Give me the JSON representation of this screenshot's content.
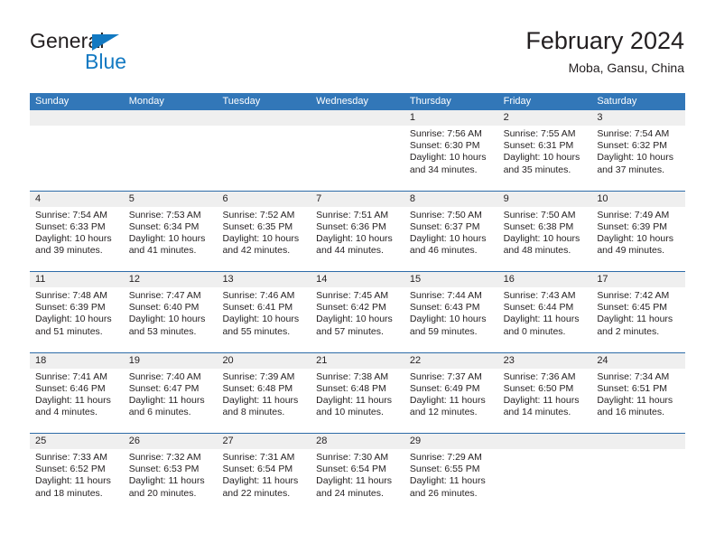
{
  "brand": {
    "name_part1": "General",
    "name_part2": "Blue",
    "triangle_icon": "blue-triangle-logo-mark",
    "accent_color": "#1279c2"
  },
  "header": {
    "title": "February 2024",
    "subtitle": "Moba, Gansu, China"
  },
  "theme": {
    "header_blue": "#3277b8",
    "row_divider_blue": "#2e6ca8",
    "daynum_band_gray": "#efefef",
    "text_color": "#231f20"
  },
  "calendar": {
    "weekday_headers": [
      "Sunday",
      "Monday",
      "Tuesday",
      "Wednesday",
      "Thursday",
      "Friday",
      "Saturday"
    ],
    "weeks": [
      [
        {
          "day": "",
          "lines": []
        },
        {
          "day": "",
          "lines": []
        },
        {
          "day": "",
          "lines": []
        },
        {
          "day": "",
          "lines": []
        },
        {
          "day": "1",
          "lines": [
            "Sunrise: 7:56 AM",
            "Sunset: 6:30 PM",
            "Daylight: 10 hours",
            "and 34 minutes."
          ]
        },
        {
          "day": "2",
          "lines": [
            "Sunrise: 7:55 AM",
            "Sunset: 6:31 PM",
            "Daylight: 10 hours",
            "and 35 minutes."
          ]
        },
        {
          "day": "3",
          "lines": [
            "Sunrise: 7:54 AM",
            "Sunset: 6:32 PM",
            "Daylight: 10 hours",
            "and 37 minutes."
          ]
        }
      ],
      [
        {
          "day": "4",
          "lines": [
            "Sunrise: 7:54 AM",
            "Sunset: 6:33 PM",
            "Daylight: 10 hours",
            "and 39 minutes."
          ]
        },
        {
          "day": "5",
          "lines": [
            "Sunrise: 7:53 AM",
            "Sunset: 6:34 PM",
            "Daylight: 10 hours",
            "and 41 minutes."
          ]
        },
        {
          "day": "6",
          "lines": [
            "Sunrise: 7:52 AM",
            "Sunset: 6:35 PM",
            "Daylight: 10 hours",
            "and 42 minutes."
          ]
        },
        {
          "day": "7",
          "lines": [
            "Sunrise: 7:51 AM",
            "Sunset: 6:36 PM",
            "Daylight: 10 hours",
            "and 44 minutes."
          ]
        },
        {
          "day": "8",
          "lines": [
            "Sunrise: 7:50 AM",
            "Sunset: 6:37 PM",
            "Daylight: 10 hours",
            "and 46 minutes."
          ]
        },
        {
          "day": "9",
          "lines": [
            "Sunrise: 7:50 AM",
            "Sunset: 6:38 PM",
            "Daylight: 10 hours",
            "and 48 minutes."
          ]
        },
        {
          "day": "10",
          "lines": [
            "Sunrise: 7:49 AM",
            "Sunset: 6:39 PM",
            "Daylight: 10 hours",
            "and 49 minutes."
          ]
        }
      ],
      [
        {
          "day": "11",
          "lines": [
            "Sunrise: 7:48 AM",
            "Sunset: 6:39 PM",
            "Daylight: 10 hours",
            "and 51 minutes."
          ]
        },
        {
          "day": "12",
          "lines": [
            "Sunrise: 7:47 AM",
            "Sunset: 6:40 PM",
            "Daylight: 10 hours",
            "and 53 minutes."
          ]
        },
        {
          "day": "13",
          "lines": [
            "Sunrise: 7:46 AM",
            "Sunset: 6:41 PM",
            "Daylight: 10 hours",
            "and 55 minutes."
          ]
        },
        {
          "day": "14",
          "lines": [
            "Sunrise: 7:45 AM",
            "Sunset: 6:42 PM",
            "Daylight: 10 hours",
            "and 57 minutes."
          ]
        },
        {
          "day": "15",
          "lines": [
            "Sunrise: 7:44 AM",
            "Sunset: 6:43 PM",
            "Daylight: 10 hours",
            "and 59 minutes."
          ]
        },
        {
          "day": "16",
          "lines": [
            "Sunrise: 7:43 AM",
            "Sunset: 6:44 PM",
            "Daylight: 11 hours",
            "and 0 minutes."
          ]
        },
        {
          "day": "17",
          "lines": [
            "Sunrise: 7:42 AM",
            "Sunset: 6:45 PM",
            "Daylight: 11 hours",
            "and 2 minutes."
          ]
        }
      ],
      [
        {
          "day": "18",
          "lines": [
            "Sunrise: 7:41 AM",
            "Sunset: 6:46 PM",
            "Daylight: 11 hours",
            "and 4 minutes."
          ]
        },
        {
          "day": "19",
          "lines": [
            "Sunrise: 7:40 AM",
            "Sunset: 6:47 PM",
            "Daylight: 11 hours",
            "and 6 minutes."
          ]
        },
        {
          "day": "20",
          "lines": [
            "Sunrise: 7:39 AM",
            "Sunset: 6:48 PM",
            "Daylight: 11 hours",
            "and 8 minutes."
          ]
        },
        {
          "day": "21",
          "lines": [
            "Sunrise: 7:38 AM",
            "Sunset: 6:48 PM",
            "Daylight: 11 hours",
            "and 10 minutes."
          ]
        },
        {
          "day": "22",
          "lines": [
            "Sunrise: 7:37 AM",
            "Sunset: 6:49 PM",
            "Daylight: 11 hours",
            "and 12 minutes."
          ]
        },
        {
          "day": "23",
          "lines": [
            "Sunrise: 7:36 AM",
            "Sunset: 6:50 PM",
            "Daylight: 11 hours",
            "and 14 minutes."
          ]
        },
        {
          "day": "24",
          "lines": [
            "Sunrise: 7:34 AM",
            "Sunset: 6:51 PM",
            "Daylight: 11 hours",
            "and 16 minutes."
          ]
        }
      ],
      [
        {
          "day": "25",
          "lines": [
            "Sunrise: 7:33 AM",
            "Sunset: 6:52 PM",
            "Daylight: 11 hours",
            "and 18 minutes."
          ]
        },
        {
          "day": "26",
          "lines": [
            "Sunrise: 7:32 AM",
            "Sunset: 6:53 PM",
            "Daylight: 11 hours",
            "and 20 minutes."
          ]
        },
        {
          "day": "27",
          "lines": [
            "Sunrise: 7:31 AM",
            "Sunset: 6:54 PM",
            "Daylight: 11 hours",
            "and 22 minutes."
          ]
        },
        {
          "day": "28",
          "lines": [
            "Sunrise: 7:30 AM",
            "Sunset: 6:54 PM",
            "Daylight: 11 hours",
            "and 24 minutes."
          ]
        },
        {
          "day": "29",
          "lines": [
            "Sunrise: 7:29 AM",
            "Sunset: 6:55 PM",
            "Daylight: 11 hours",
            "and 26 minutes."
          ]
        },
        {
          "day": "",
          "lines": []
        },
        {
          "day": "",
          "lines": []
        }
      ]
    ]
  }
}
